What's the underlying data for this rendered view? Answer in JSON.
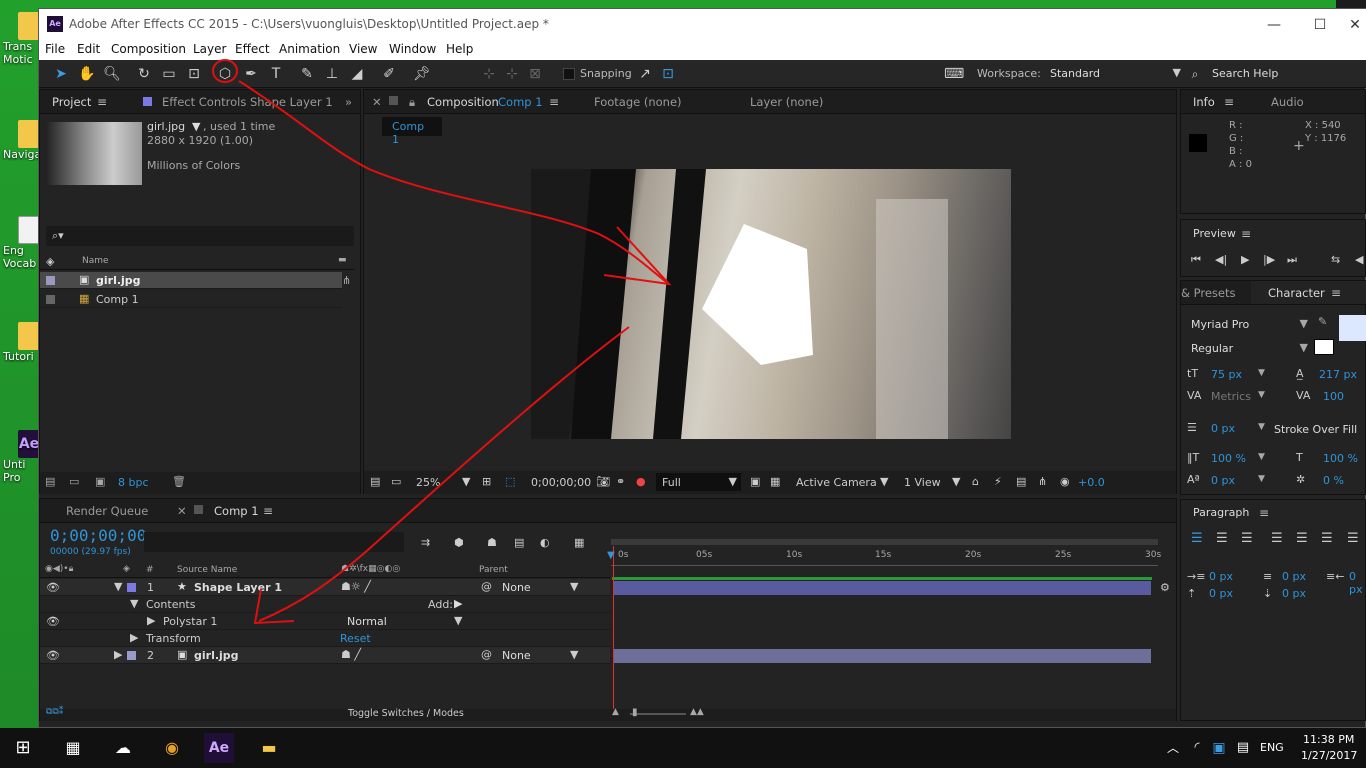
{
  "desktop": {
    "icons": [
      {
        "label": "Trans",
        "label2": "Motic",
        "kind": "folder"
      },
      {
        "label": "Naviga",
        "label2": "",
        "kind": "folder"
      },
      {
        "label": "Eng",
        "label2": "Vocab",
        "kind": "doc"
      },
      {
        "label": "Tutori",
        "label2": "",
        "kind": "folder"
      },
      {
        "label": "Unti",
        "label2": "Pro",
        "kind": "ae"
      }
    ]
  },
  "window": {
    "title": "Adobe After Effects CC 2015 - C:\\Users\\vuongluis\\Desktop\\Untitled Project.aep *",
    "app_icon": "Ae",
    "controls": {
      "minimize": "—",
      "maximize": "☐",
      "close": "✕"
    }
  },
  "menu": [
    "File",
    "Edit",
    "Composition",
    "Layer",
    "Effect",
    "Animation",
    "View",
    "Window",
    "Help"
  ],
  "toolbar": {
    "snapping_label": "Snapping",
    "workspace_label": "Workspace:",
    "workspace_value": "Standard",
    "search_help": "Search Help"
  },
  "project_panel": {
    "tab_project": "Project",
    "tab_effect_controls": "Effect Controls Shape Layer 1",
    "item_name": "girl.jpg",
    "item_usage": ", used 1 time",
    "item_dims": "2880 x 1920 (1.00)",
    "item_colors": "Millions of Colors",
    "search_placeholder": "",
    "col_name": "Name",
    "items": [
      {
        "name": "girl.jpg",
        "type": "image"
      },
      {
        "name": "Comp 1",
        "type": "comp"
      }
    ],
    "bpc": "8 bpc"
  },
  "comp_panel": {
    "tab_composition_prefix": "Composition",
    "tab_composition_name": "Comp 1",
    "tab_footage": "Footage (none)",
    "tab_layer": "Layer (none)",
    "breadcrumb": "Comp 1",
    "zoom": "25%",
    "timecode": "0;00;00;00",
    "resolution": "Full",
    "camera": "Active Camera",
    "views": "1 View",
    "exposure": "+0.0"
  },
  "info_panel": {
    "tab_info": "Info",
    "tab_audio": "Audio",
    "r": "R :",
    "g": "G :",
    "b": "B :",
    "a": "A :  0",
    "x": "X : 540",
    "y": "Y : 1176"
  },
  "preview_panel": {
    "title": "Preview"
  },
  "character_panel": {
    "tab_presets": "& Presets",
    "tab_character": "Character",
    "font": "Myriad Pro",
    "style": "Regular",
    "size": "75 px",
    "leading": "217 px",
    "kerning": "Metrics",
    "tracking": "100",
    "stroke_width": "0 px",
    "stroke_mode": "Stroke Over Fill",
    "vscale": "100 %",
    "hscale": "100 %",
    "baseline": "0 px",
    "tsume": "0 %"
  },
  "paragraph_panel": {
    "title": "Paragraph",
    "indent_left": "0 px",
    "indent_first": "0 px",
    "indent_right": "0 px",
    "space_before": "0 px",
    "space_after": "0 px"
  },
  "timeline": {
    "tab_render_queue": "Render Queue",
    "tab_comp": "Comp 1",
    "timecode": "0;00;00;00",
    "fps": "00000 (29.97 fps)",
    "col_source": "Source Name",
    "col_parent": "Parent",
    "ruler": [
      "0s",
      "05s",
      "10s",
      "15s",
      "20s",
      "25s",
      "30s"
    ],
    "layers": [
      {
        "num": "1",
        "name": "Shape Layer 1",
        "parent": "None",
        "color": "#7a7ae0"
      },
      {
        "num": "",
        "name": "Contents",
        "extra": "Add:"
      },
      {
        "num": "",
        "name": "Polystar 1",
        "mode": "Normal"
      },
      {
        "num": "",
        "name": "Transform",
        "extra": "Reset"
      },
      {
        "num": "2",
        "name": "girl.jpg",
        "parent": "None",
        "color": "#9a9ac8"
      }
    ],
    "toggle": "Toggle Switches / Modes"
  },
  "taskbar": {
    "time": "11:38 PM",
    "date": "1/27/2017",
    "lang": "ENG"
  }
}
